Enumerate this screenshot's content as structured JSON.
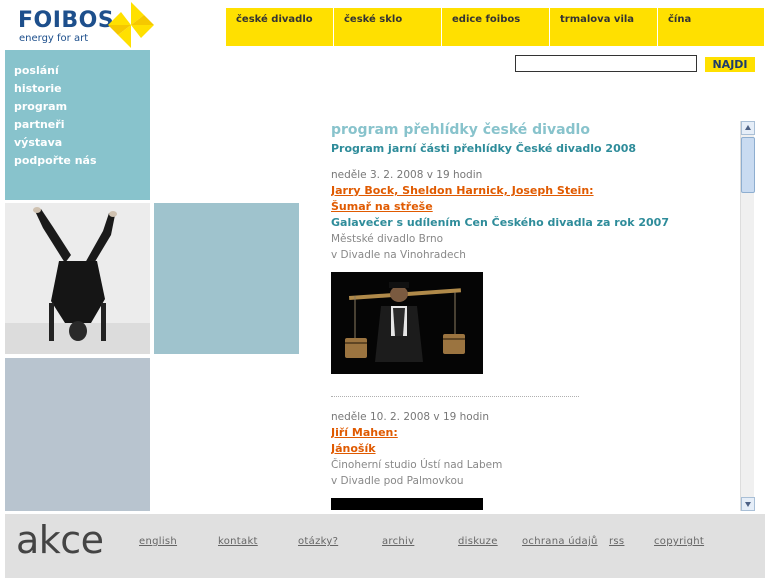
{
  "logo": {
    "name": "FOIBOS",
    "tagline": "energy for art",
    "accent": "#ffe000",
    "brand_color": "#1d4f8c"
  },
  "topnav": [
    "české divadlo",
    "české sklo",
    "edice foibos",
    "trmalova vila",
    "čína"
  ],
  "search": {
    "value": "",
    "button_label": "NAJDI"
  },
  "leftmenu": [
    "poslání",
    "historie",
    "program",
    "partneři",
    "výstava",
    "podpořte nás"
  ],
  "main": {
    "heading": "program přehlídky české divadlo",
    "subheading": "Program jarní části přehlídky České divadlo 2008",
    "events": [
      {
        "date": "neděle 3. 2. 2008 v 19 hodin",
        "author_link": "Jarry Bock, Sheldon Harnick, Joseph Stein:",
        "play_link": "Šumař na střeše",
        "title": "Galavečer s udílením Cen Českého divadla za rok 2007",
        "company": "Městské divadlo Brno",
        "venue": "v Divadle na Vinohradech"
      },
      {
        "date": "neděle 10. 2. 2008 v 19 hodin",
        "author_link": "Jiří Mahen:",
        "play_link": "Jánošík ",
        "company": "Činoherní studio Ústí nad Labem",
        "venue": "v Divadle pod Palmovkou"
      }
    ]
  },
  "footer": {
    "title": "akce",
    "links": [
      "english",
      "kontakt",
      "otázky?",
      "archiv",
      "diskuze",
      "ochrana údajů",
      "rss",
      "copyright"
    ]
  },
  "colors": {
    "menu_bg": "#88c3cc",
    "nav_bg": "#ffe000",
    "link": "#e05a00",
    "teal_text": "#2e8c9a"
  }
}
